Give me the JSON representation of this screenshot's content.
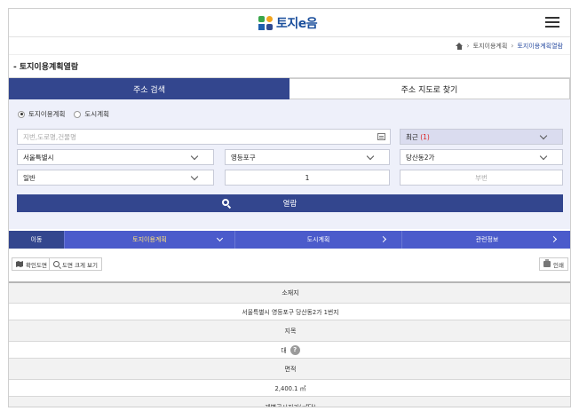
{
  "header": {
    "logo_text": "토지e음",
    "menu_icon": "hamburger-menu-icon"
  },
  "breadcrumb": {
    "item1": "토지이용계획",
    "item2": "토지이용계획열람"
  },
  "page_title": "- 토지이용계획열람",
  "tabs": {
    "address_search": "주소 검색",
    "map_search": "주소 지도로 찾기"
  },
  "search": {
    "radio_land_use": "토지이용계획",
    "radio_city_plan": "도시계획",
    "address_placeholder": "지번,도로명,건물명",
    "recent_label": "최근",
    "recent_count": "(1)",
    "city": "서울특별시",
    "district": "영등포구",
    "dong": "당산동2가",
    "land_type": "일반",
    "main_number": "1",
    "sub_number_placeholder": "부번",
    "view_button": "열람"
  },
  "nav": {
    "move": "이동",
    "land_use_plan": "토지이용계획",
    "city_plan": "도시계획",
    "related_info": "관련정보"
  },
  "toolbar": {
    "confirm_map": "확인도면",
    "zoom_map": "도면 크게 보기",
    "print": "인쇄"
  },
  "info": {
    "location_label": "소재지",
    "location_value": "서울특별시 영등포구 당산동2가 1번지",
    "category_label": "지목",
    "category_value": "대",
    "area_label": "면적",
    "area_value": "2,400.1 ㎡",
    "price_label": "개별공시지가(㎡당)"
  }
}
